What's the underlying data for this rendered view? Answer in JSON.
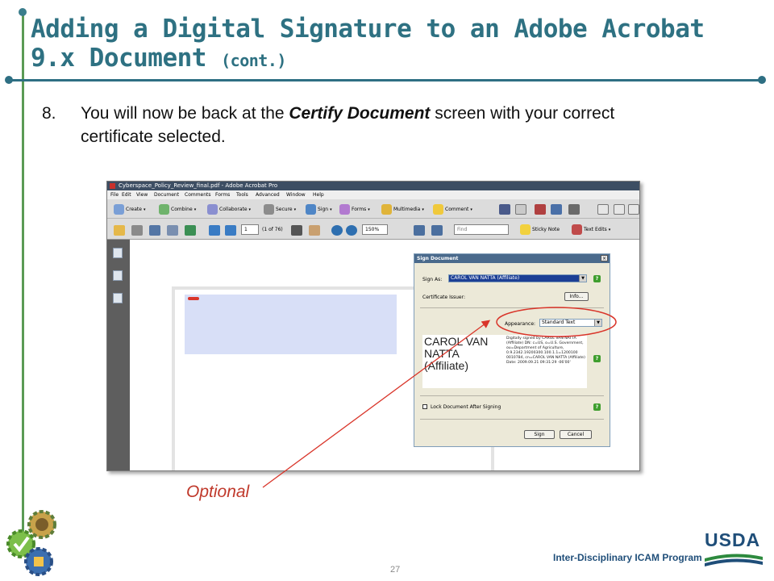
{
  "slide": {
    "title_main": "Adding a Digital Signature to an Adobe Acrobat 9.x Document",
    "title_cont": "(cont.)",
    "step_number": "8.",
    "step_text_before": "You will now be back at the ",
    "step_text_emphasis": "Certify Document",
    "step_text_after": " screen with your correct certificate selected.",
    "callout_label": "Optional",
    "footer_program": "Inter-Disciplinary ICAM Program",
    "page_number": "27",
    "logo_text": "USDA",
    "colors": {
      "title": "#2e7182",
      "callout": "#c0392b",
      "accent_green": "#5b9a55"
    }
  },
  "acrobat": {
    "window_title": "Cyberspace_Policy_Review_final.pdf - Adobe Acrobat Pro",
    "menu": [
      "File",
      "Edit",
      "View",
      "Document",
      "Comments",
      "Forms",
      "Tools",
      "Advanced",
      "Window",
      "Help"
    ],
    "toolbar1": {
      "create": "Create",
      "combine": "Combine",
      "collaborate": "Collaborate",
      "secure": "Secure",
      "sign": "Sign",
      "forms": "Forms",
      "multimedia": "Multimedia",
      "comment": "Comment"
    },
    "toolbar2": {
      "page_value": "1",
      "page_of": "(1 of 76)",
      "zoom_value": "150%",
      "find_placeholder": "Find",
      "sticky_note": "Sticky Note",
      "text_edits": "Text Edits"
    },
    "dialog": {
      "title": "Sign Document",
      "sign_as_label": "Sign As:",
      "sign_as_value": "CAROL VAN NATTA (Affiliate)",
      "issuer_label": "Certificate Issuer:",
      "info_button": "Info...",
      "appearance_label": "Appearance:",
      "appearance_value": "Standard Text",
      "preview_name": "CAROL VAN NATTA (Affiliate)",
      "preview_details": "Digitally signed by CAROL VAN NATTA (Affiliate) DN: c=US, o=U.S. Government, ou=Department of Agriculture, 0.9.2342.19200300.100.1.1=1200100 0010784, cn=CAROL VAN NATTA (Affiliate) Date: 2009.09.21 09:31:29 -06'00'",
      "lock_label": "Lock Document After Signing",
      "sign_button": "Sign",
      "cancel_button": "Cancel",
      "help_glyph": "?"
    }
  }
}
